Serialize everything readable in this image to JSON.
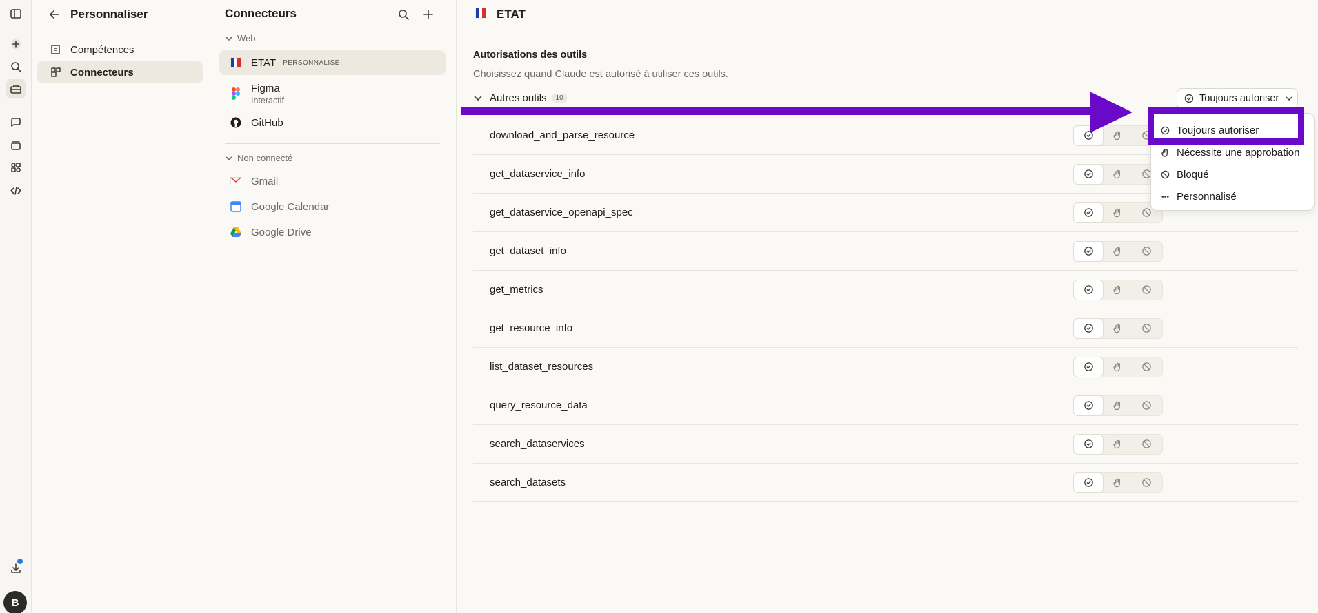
{
  "panel1": {
    "title": "Personnaliser",
    "items": [
      {
        "label": "Compétences"
      },
      {
        "label": "Connecteurs"
      }
    ]
  },
  "panel2": {
    "title": "Connecteurs",
    "group_web": "Web",
    "group_disconnected": "Non connecté",
    "connected": [
      {
        "name": "ETAT",
        "tag": "PERSONNALISÉ"
      },
      {
        "name": "Figma",
        "sub": "Interactif"
      },
      {
        "name": "GitHub"
      }
    ],
    "disconnected": [
      {
        "name": "Gmail"
      },
      {
        "name": "Google Calendar"
      },
      {
        "name": "Google Drive"
      }
    ]
  },
  "main": {
    "title": "ETAT",
    "section_title": "Autorisations des outils",
    "section_sub": "Choisissez quand Claude est autorisé à utiliser ces outils.",
    "tools_group": "Autres outils",
    "tools_count": "10",
    "selector_label": "Toujours autoriser",
    "tools": [
      "download_and_parse_resource",
      "get_dataservice_info",
      "get_dataservice_openapi_spec",
      "get_dataset_info",
      "get_metrics",
      "get_resource_info",
      "list_dataset_resources",
      "query_resource_data",
      "search_dataservices",
      "search_datasets"
    ]
  },
  "dropdown": {
    "options": [
      "Toujours autoriser",
      "Nécessite une approbation",
      "Bloqué",
      "Personnalisé"
    ]
  },
  "user": {
    "initial": "B"
  },
  "colors": {
    "annotation": "#6b09c9",
    "background": "#faf9f5",
    "notification": "#2f7ad8"
  }
}
